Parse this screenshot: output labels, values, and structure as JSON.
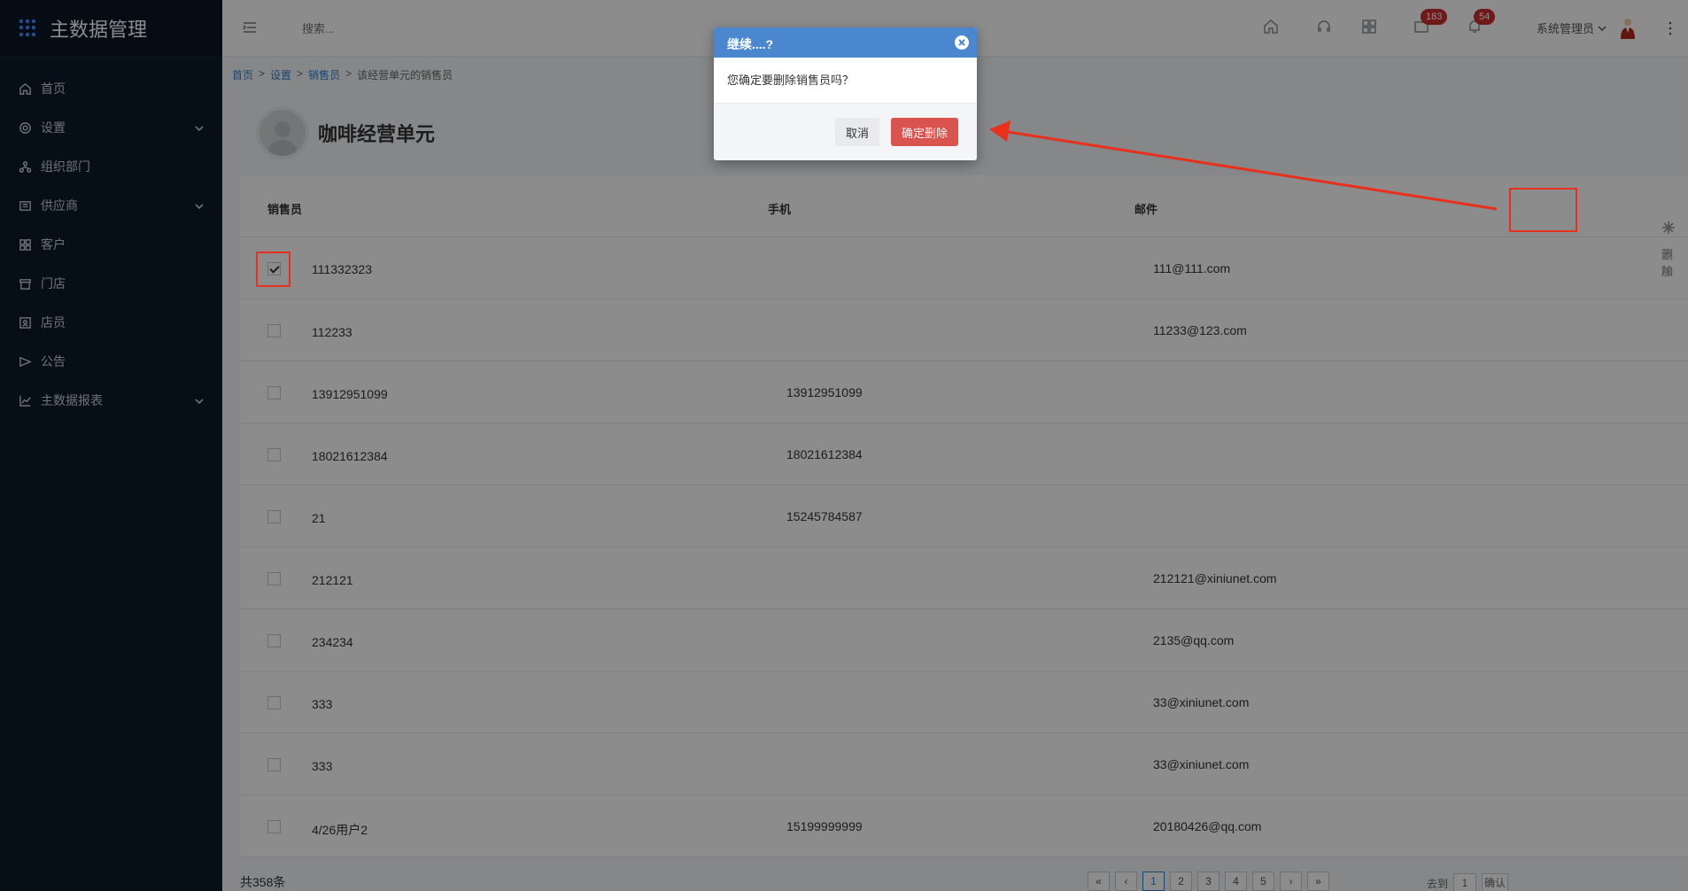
{
  "app": {
    "title": "主数据管理"
  },
  "sidebar": {
    "items": [
      {
        "label": "首页",
        "icon": "home-icon",
        "expandable": false
      },
      {
        "label": "设置",
        "icon": "settings-icon",
        "expandable": true
      },
      {
        "label": "组织部门",
        "icon": "org-icon",
        "expandable": false
      },
      {
        "label": "供应商",
        "icon": "supplier-icon",
        "expandable": true
      },
      {
        "label": "客户",
        "icon": "customer-icon",
        "expandable": false
      },
      {
        "label": "门店",
        "icon": "store-icon",
        "expandable": false
      },
      {
        "label": "店员",
        "icon": "clerk-icon",
        "expandable": false
      },
      {
        "label": "公告",
        "icon": "announcement-icon",
        "expandable": false
      },
      {
        "label": "主数据报表",
        "icon": "report-icon",
        "expandable": true
      }
    ]
  },
  "topbar": {
    "search_placeholder": "搜索...",
    "badges": {
      "messages": "183",
      "notifications": "54"
    },
    "user_name": "系统管理员"
  },
  "breadcrumb": {
    "home": "首页",
    "settings": "设置",
    "salespeople": "销售员",
    "current": "该经营单元的销售员",
    "sep": ">"
  },
  "page": {
    "title": "咖啡经营单元"
  },
  "table": {
    "headers": {
      "name": "销售员",
      "phone": "手机",
      "email": "邮件"
    },
    "actions": {
      "delete": "删除",
      "add": "添加"
    },
    "rows": [
      {
        "name": "111332323",
        "phone": "",
        "email": "111@111.com",
        "checked": true
      },
      {
        "name": "112233",
        "phone": "",
        "email": "11233@123.com",
        "checked": false
      },
      {
        "name": "13912951099",
        "phone": "13912951099",
        "email": "",
        "checked": false
      },
      {
        "name": "18021612384",
        "phone": "18021612384",
        "email": "",
        "checked": false
      },
      {
        "name": "21",
        "phone": "15245784587",
        "email": "",
        "checked": false
      },
      {
        "name": "212121",
        "phone": "",
        "email": "212121@xiniunet.com",
        "checked": false
      },
      {
        "name": "234234",
        "phone": "",
        "email": "2135@qq.com",
        "checked": false
      },
      {
        "name": "333",
        "phone": "",
        "email": "33@xiniunet.com",
        "checked": false
      },
      {
        "name": "333",
        "phone": "",
        "email": "33@xiniunet.com",
        "checked": false
      },
      {
        "name": "4/26用户2",
        "phone": "15199999999",
        "email": "20180426@qq.com",
        "checked": false
      }
    ]
  },
  "footer": {
    "total": "共358条",
    "pages": [
      "«",
      "‹",
      "1",
      "2",
      "3",
      "4",
      "5",
      "›",
      "»"
    ],
    "active_page": "1",
    "goto_label": "去到",
    "goto_value": "1",
    "goto_button": "确认"
  },
  "modal": {
    "title": "继续....?",
    "message": "您确定要删除销售员吗？",
    "cancel": "取消",
    "confirm": "确定删除"
  },
  "colors": {
    "sidebar_bg": "#0b1a2c",
    "accent": "#4a87cf",
    "danger": "#d9534f",
    "annotation": "#e8301c"
  }
}
